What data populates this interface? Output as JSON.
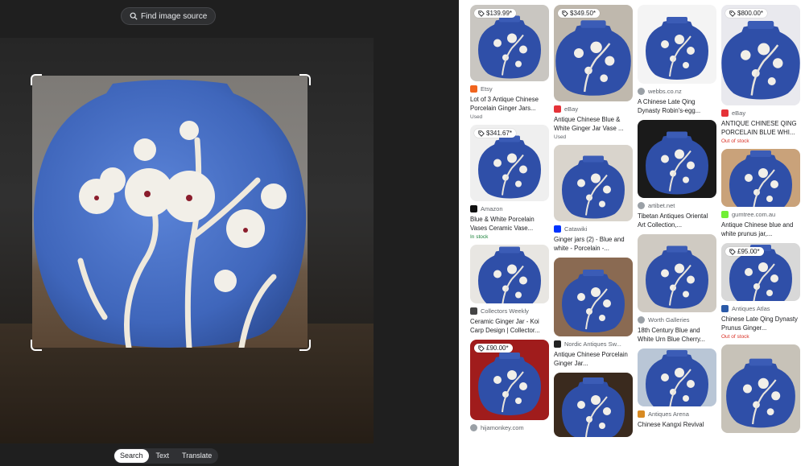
{
  "toolbar": {
    "find_source_label": "Find image source",
    "find_source_icon": "lens-search-icon"
  },
  "modes": [
    {
      "label": "Search",
      "active": true
    },
    {
      "label": "Text",
      "active": false
    },
    {
      "label": "Translate",
      "active": false
    }
  ],
  "colors": {
    "jar_blue": "#4a6fc4",
    "blossom": "#f2efe8",
    "in_stock": "#188038",
    "out_of_stock": "#d93025",
    "used": "#5f6368"
  },
  "results": {
    "col1": [
      {
        "price": "$139.99*",
        "source": "Etsy",
        "favicon": "etsy-icon",
        "title": "Lot of 3 Antique Chinese Porcelain Ginger Jars...",
        "status": "Used",
        "status_type": "used"
      },
      {
        "price": "$341.67*",
        "source": "Amazon",
        "favicon": "amazon-icon",
        "title": "Blue & White Porcelain Vases Ceramic Vase...",
        "status": "In stock",
        "status_type": "in"
      },
      {
        "price": "",
        "source": "Collectors Weekly",
        "favicon": "collectors-weekly-icon",
        "title": "Ceramic Ginger Jar - Koi Carp Design | Collector...",
        "status": "",
        "status_type": ""
      },
      {
        "price": "£90.00*",
        "source": "hijamonkey.com",
        "favicon": "globe-icon",
        "title": "",
        "status": "",
        "status_type": ""
      }
    ],
    "col2": [
      {
        "price": "$349.50*",
        "source": "eBay",
        "favicon": "ebay-icon",
        "title": "Antique Chinese Blue & White Ginger Jar Vase ...",
        "status": "Used",
        "status_type": "used"
      },
      {
        "price": "",
        "source": "Catawiki",
        "favicon": "catawiki-icon",
        "title": "Ginger jars (2) - Blue and white - Porcelain -...",
        "status": "",
        "status_type": ""
      },
      {
        "price": "",
        "source": "Nordic Antiques Sw...",
        "favicon": "nordic-antiques-icon",
        "title": "Antique Chinese Porcelain Ginger Jar...",
        "status": "",
        "status_type": ""
      },
      {
        "price": "",
        "source": "",
        "favicon": "",
        "title": "",
        "status": "",
        "status_type": ""
      }
    ],
    "col3": [
      {
        "price": "",
        "source": "webbs.co.nz",
        "favicon": "globe-icon",
        "title": "A Chinese Late Qing Dynasty Robin's-egg...",
        "status": "",
        "status_type": ""
      },
      {
        "price": "",
        "source": "artibet.net",
        "favicon": "globe-icon",
        "title": "Tibetan Antiques Oriental Art Collection,...",
        "status": "",
        "status_type": ""
      },
      {
        "price": "",
        "source": "Worth Galleries",
        "favicon": "globe-icon",
        "title": "18th Century Blue and White Urn Blue Cherry...",
        "status": "",
        "status_type": ""
      },
      {
        "price": "",
        "source": "Antiques Arena",
        "favicon": "antiques-arena-icon",
        "title": "Chinese Kangxi Revival",
        "status": "",
        "status_type": ""
      }
    ],
    "col4": [
      {
        "price": "$800.00*",
        "source": "eBay",
        "favicon": "ebay-icon",
        "title": "ANTIQUE CHINESE QING PORCELAIN BLUE WHI...",
        "status": "Out of stock",
        "status_type": "out"
      },
      {
        "price": "",
        "source": "gumtree.com.au",
        "favicon": "gumtree-icon",
        "title": "Antique Chinese blue and white prunus jar,...",
        "status": "",
        "status_type": ""
      },
      {
        "price": "£95.00*",
        "source": "Antiques Atlas",
        "favicon": "antiques-atlas-icon",
        "title": "Chinese Late Qing Dynasty Prunus Ginger...",
        "status": "Out of stock",
        "status_type": "out"
      },
      {
        "price": "",
        "source": "",
        "favicon": "",
        "title": "",
        "status": "",
        "status_type": ""
      }
    ]
  }
}
